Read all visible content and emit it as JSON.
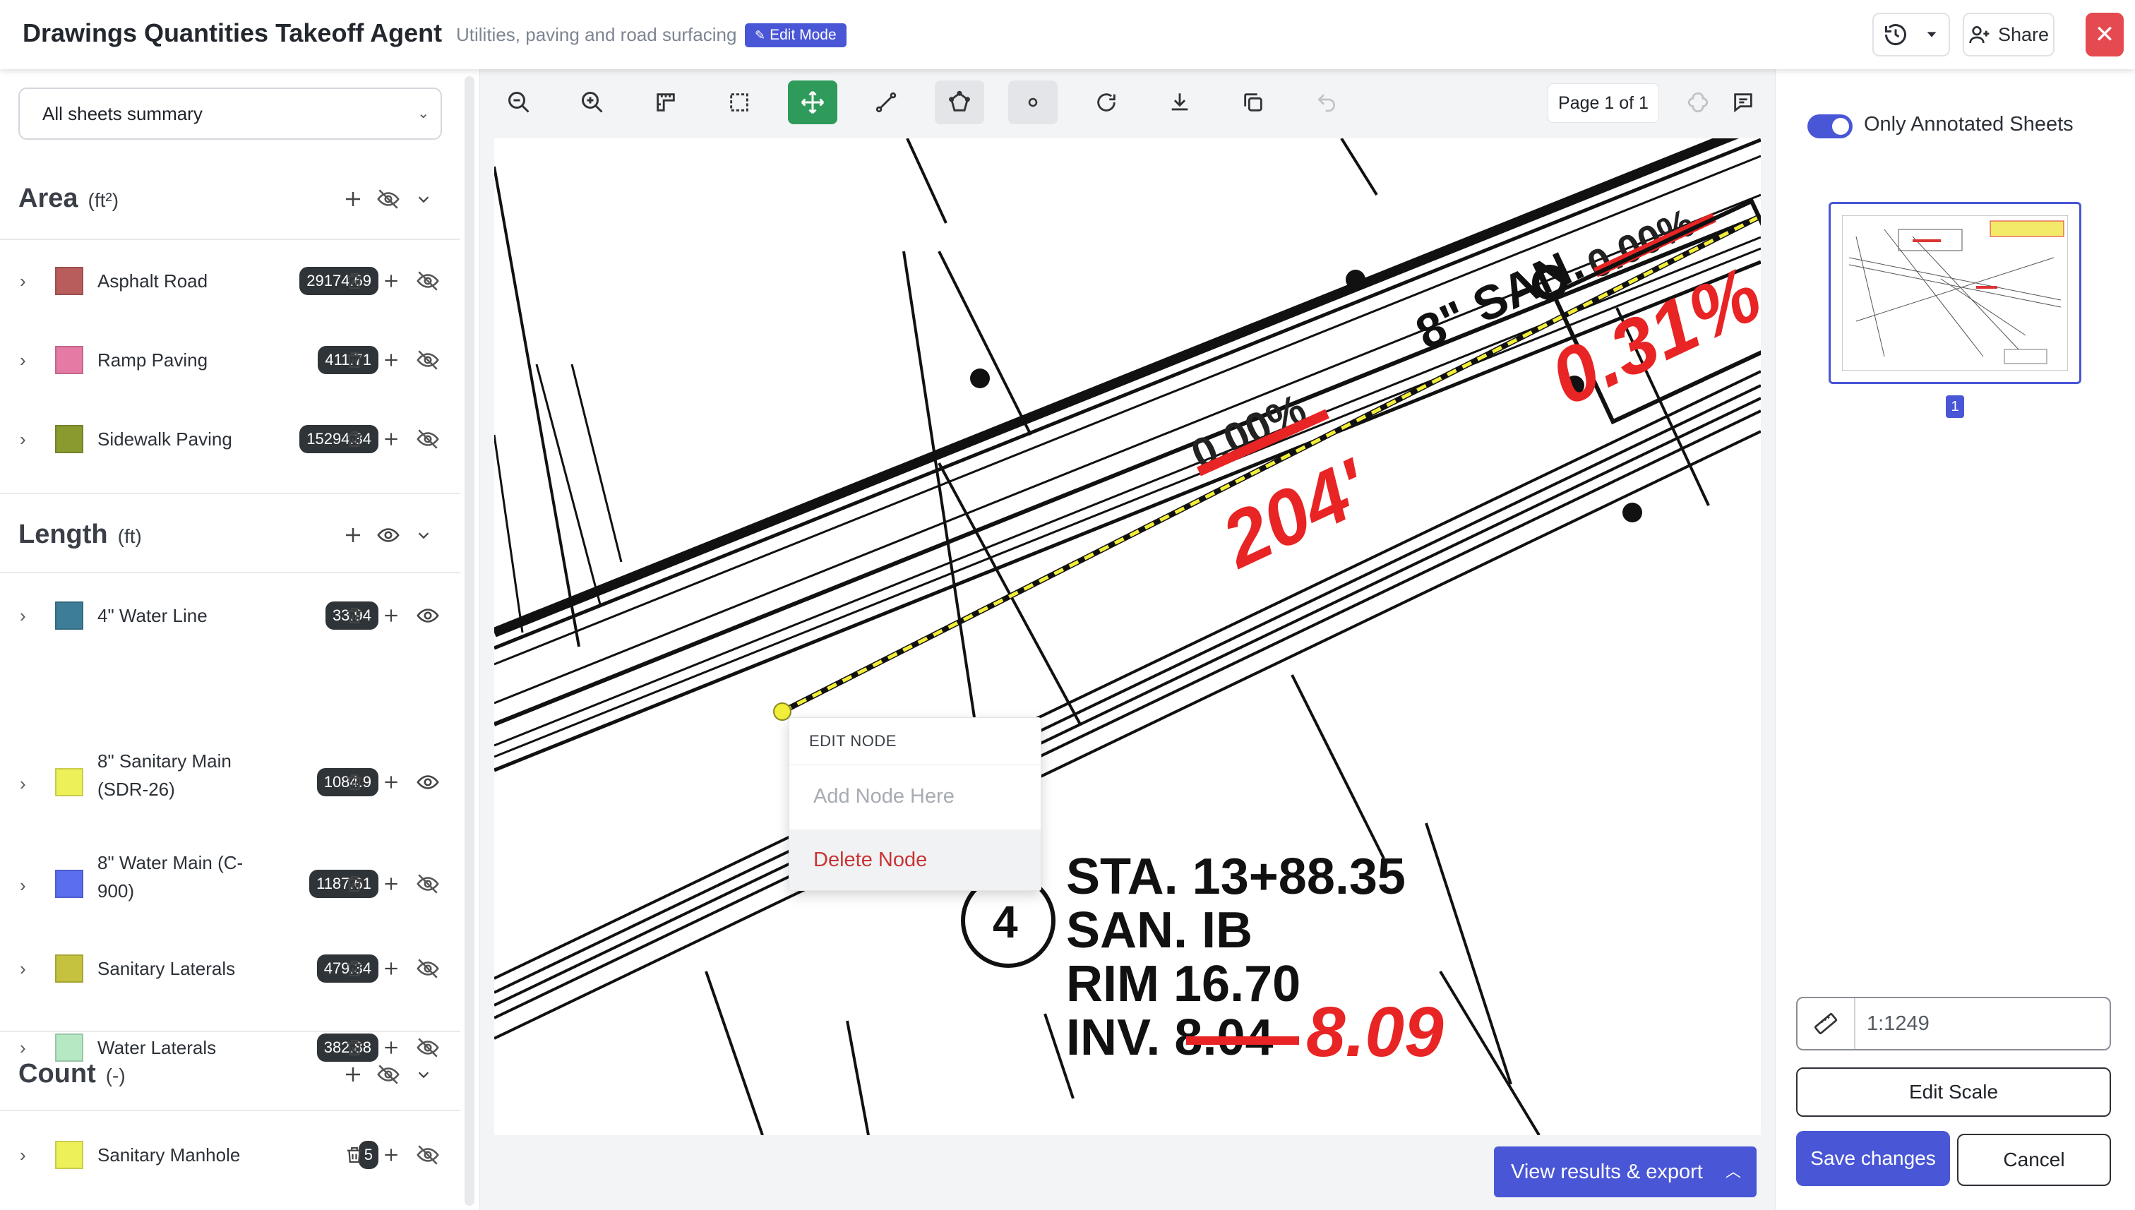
{
  "header": {
    "title": "Drawings Quantities Takeoff Agent",
    "subtitle": "Utilities, paving and road surfacing",
    "mode_badge": "Edit Mode",
    "share_label": "Share",
    "icons": {
      "history": "history-icon",
      "dropdown": "chevron-down-icon",
      "share": "add-user-icon",
      "close": "close-icon"
    }
  },
  "sidebar": {
    "sheet_select": "All sheets summary",
    "sections": [
      {
        "title": "Area",
        "unit": "(ft²)",
        "visibility": "hidden",
        "items": [
          {
            "label": "Asphalt Road",
            "value": "29174.69",
            "color": "#b85c5c",
            "visible": false
          },
          {
            "label": "Ramp Paving",
            "value": "411.71",
            "color": "#e57aa4",
            "visible": false
          },
          {
            "label": "Sidewalk Paving",
            "value": "15294.34",
            "color": "#8a9a2e",
            "visible": false
          }
        ]
      },
      {
        "title": "Length",
        "unit": "(ft)",
        "visibility": "visible",
        "items": [
          {
            "label": "4\" Water Line",
            "value": "33.94",
            "color": "#3d7d98",
            "visible": true
          },
          {
            "label": "8\" Sanitary Main (SDR-26)",
            "label_line1": "8\" Sanitary Main",
            "label_line2": "(SDR-26)",
            "value": "1084.9",
            "color": "#eef05a",
            "visible": true
          },
          {
            "label": "8\" Water Main (C-900)",
            "label_line1": "8\" Water Main (C-",
            "label_line2": "900)",
            "value": "1187.61",
            "color": "#5b6ef0",
            "visible": false
          },
          {
            "label": "Sanitary Laterals",
            "value": "479.34",
            "color": "#c4c23f",
            "visible": false
          },
          {
            "label": "Water Laterals",
            "value": "382.88",
            "color": "#b6e8c4",
            "visible": false
          }
        ]
      },
      {
        "title": "Count",
        "unit": "(-)",
        "visibility": "hidden",
        "items": [
          {
            "label": "Sanitary Manhole",
            "value": "5",
            "color": "#eef05a",
            "visible": false
          }
        ]
      }
    ]
  },
  "toolbar": {
    "tools": [
      "zoom-out-icon",
      "zoom-in-icon",
      "measure-icon",
      "select-area-icon",
      "move-icon",
      "line-icon",
      "polygon-icon",
      "point-icon",
      "rotate-icon",
      "download-icon",
      "copy-icon",
      "undo-icon"
    ],
    "active_tool": "move-icon",
    "page_indicator": "Page 1 of 1"
  },
  "drawing": {
    "labels": {
      "san": "8\" SAN.",
      "old_length": "0.00%",
      "new_length": "204'",
      "new_slope": "0.31%",
      "manhole_no": "4",
      "sta": "STA. 13+88.35",
      "san_id": "SAN. IB",
      "rim": "RIM 16.70",
      "inv_old": "INV. 8.04",
      "inv_new": "8.09"
    }
  },
  "context_menu": {
    "heading": "EDIT NODE",
    "add": "Add Node Here",
    "delete": "Delete Node"
  },
  "view_results": "View results & export",
  "right_panel": {
    "toggle_label": "Only Annotated Sheets",
    "toggle_on": true,
    "thumbnail_page": "1",
    "scale_value": "1:1249",
    "edit_scale": "Edit Scale",
    "save": "Save changes",
    "cancel": "Cancel"
  },
  "colors": {
    "accent": "#4956d6",
    "active_tool": "#2e9b5a",
    "danger": "#e44a4f",
    "markup_red": "#e82424",
    "trace_yellow": "#f2ee3a"
  }
}
